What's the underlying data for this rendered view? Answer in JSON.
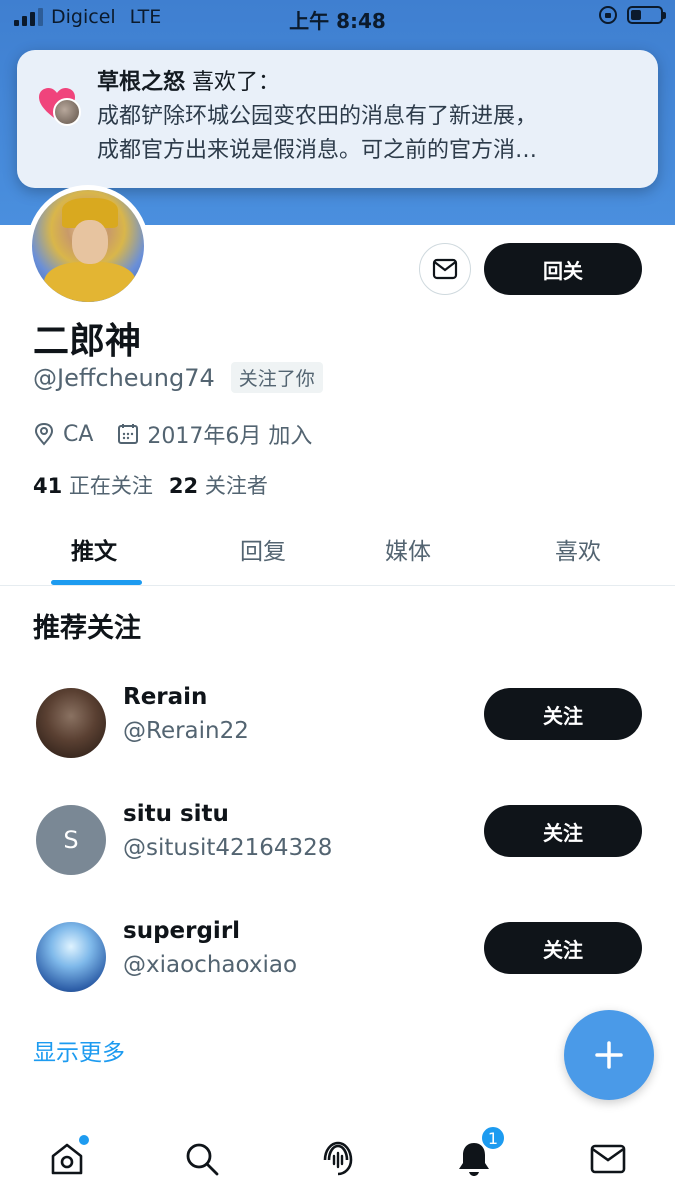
{
  "status_bar": {
    "carrier": "Digicel",
    "network": "LTE",
    "time": "上午 8:48"
  },
  "notification": {
    "actor": "草根之怒",
    "action": " 喜欢了：",
    "line1": "成都铲除环城公园变农田的消息有了新进展，",
    "line2": "成都官方出来说是假消息。可之前的官方消…",
    "icon": "heart-icon"
  },
  "profile": {
    "display_name": "二郎神",
    "handle": "@Jeffcheung74",
    "follows_you_badge": "关注了你",
    "location": "CA",
    "joined": "2017年6月 加入",
    "following_count": "41",
    "following_label": "正在关注",
    "followers_count": "22",
    "followers_label": "关注者",
    "follow_back_label": "回关"
  },
  "tabs": [
    {
      "label": "推文",
      "active": true
    },
    {
      "label": "回复",
      "active": false
    },
    {
      "label": "媒体",
      "active": false
    },
    {
      "label": "喜欢",
      "active": false
    }
  ],
  "suggestions": {
    "title": "推荐关注",
    "items": [
      {
        "name": "Rerain",
        "handle": "@Rerain22",
        "button": "关注"
      },
      {
        "name": "situ situ",
        "handle": "@situsit42164328",
        "button": "关注",
        "initial": "S"
      },
      {
        "name": "supergirl",
        "handle": "@xiaochaoxiao",
        "button": "关注"
      }
    ],
    "show_more": "显示更多"
  },
  "bottom_nav": {
    "notifications_badge": "1",
    "items": [
      "home-icon",
      "search-icon",
      "spaces-icon",
      "notifications-icon",
      "messages-icon"
    ]
  },
  "colors": {
    "accent": "#1d9bf0",
    "banner": "#4a8fde",
    "button_dark": "#0f1419",
    "heart": "#f0447c"
  }
}
